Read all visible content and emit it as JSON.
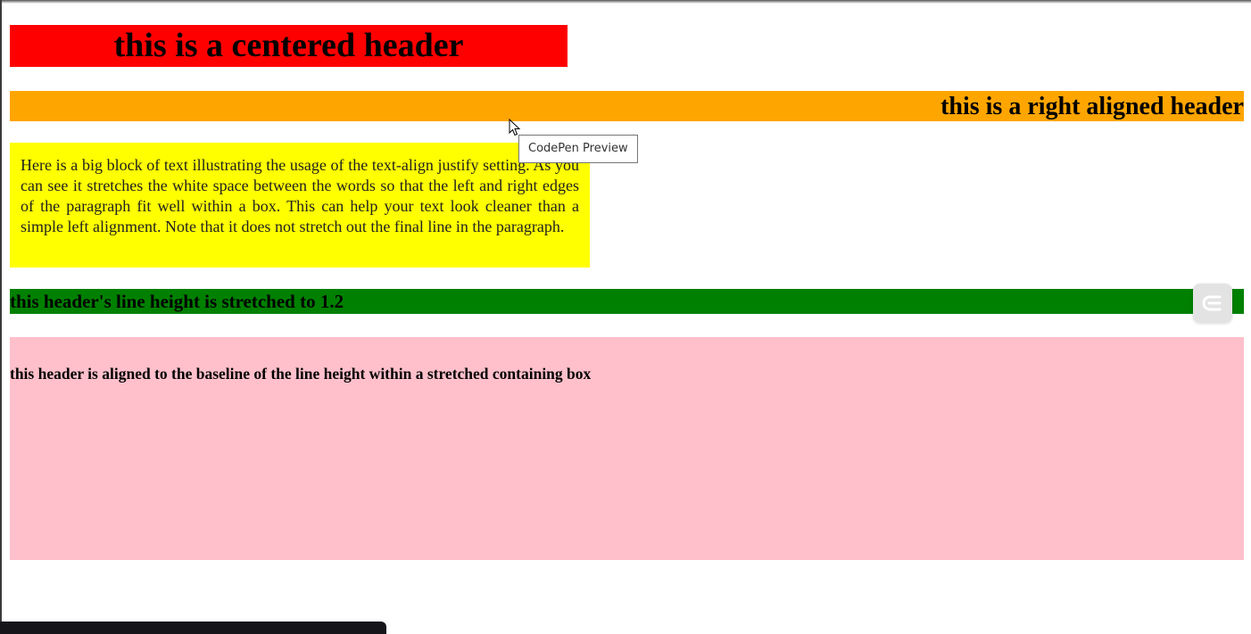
{
  "headers": {
    "centered": "this is a centered header",
    "right_aligned": "this is a right aligned header",
    "line_height": "this header's line height is stretched to 1.2",
    "baseline": "this header is aligned to the baseline of the line height within a stretched containing box"
  },
  "paragraph": {
    "text": "Here is a big block of text illustrating the usage of the text-align justify setting. As you can see it stretches the white space between the words so that the left and right edges of the paragraph fit well within a box. This can help your text look cleaner than a simple left alignment. Note that it does not stretch out the final line in the paragraph."
  },
  "tooltip": {
    "text": "CodePen Preview"
  },
  "colors": {
    "centered_bg": "#ff0000",
    "right_bg": "#ffa500",
    "justify_bg": "#ffff00",
    "line_height_bg": "#008000",
    "baseline_bg": "#ffc0cb"
  },
  "icons": {
    "cursor": "mouse-pointer-icon",
    "extension": "codepen-extension-icon"
  }
}
